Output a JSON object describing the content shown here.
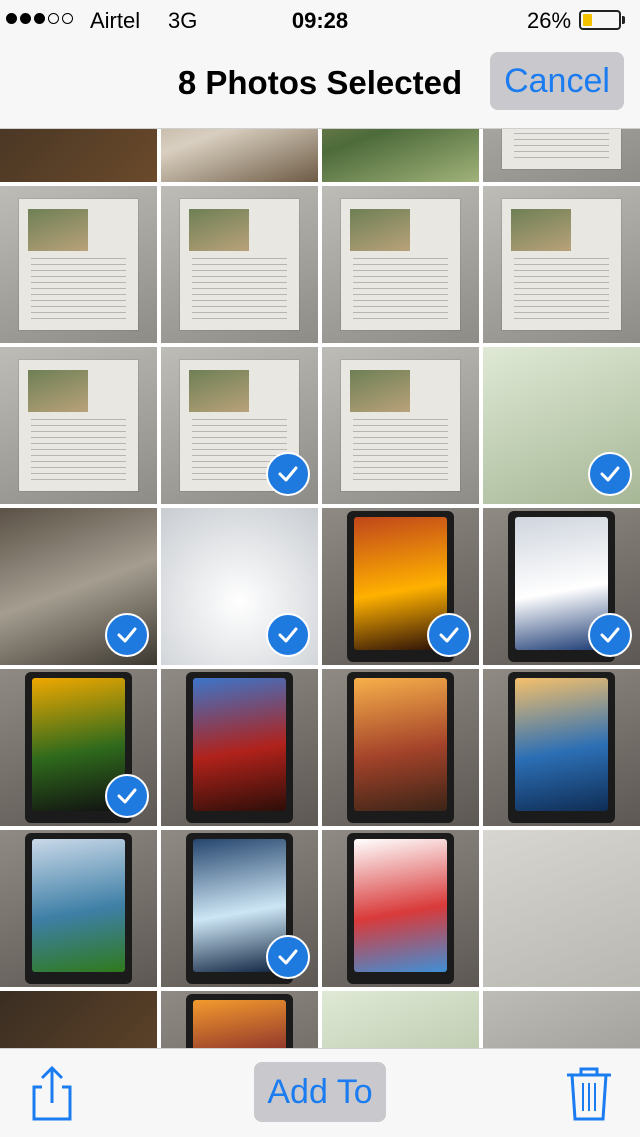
{
  "status_bar": {
    "signal_bars": [
      true,
      true,
      true,
      false,
      false
    ],
    "carrier": "Airtel",
    "network": "3G",
    "time": "09:28",
    "battery_percent": "26%",
    "battery_level": 0.26,
    "battery_color": "#f5c200"
  },
  "nav": {
    "title": "8 Photos Selected",
    "cancel_label": "Cancel"
  },
  "toolbar": {
    "share_icon": "share-icon",
    "add_to_label": "Add To",
    "trash_icon": "trash-icon"
  },
  "colors": {
    "accent": "#1a7cf0",
    "check_badge": "#1f7ae0",
    "bar_bg": "#f7f7f7",
    "button_bg": "#c9c9cd"
  },
  "photo_grid": {
    "selected_count": 8,
    "rows": [
      [
        {
          "kind": "photo",
          "theme": "t-dark",
          "selected": false
        },
        {
          "kind": "photo",
          "theme": "t-rock",
          "selected": false
        },
        {
          "kind": "photo",
          "theme": "t-garden",
          "selected": false
        },
        {
          "kind": "page",
          "theme": "t-grey",
          "selected": false
        }
      ],
      [
        {
          "kind": "page",
          "theme": "t-grey",
          "selected": false
        },
        {
          "kind": "page",
          "theme": "t-grey",
          "selected": false
        },
        {
          "kind": "page",
          "theme": "t-grey",
          "selected": false
        },
        {
          "kind": "page",
          "theme": "t-grey",
          "selected": false
        }
      ],
      [
        {
          "kind": "page",
          "theme": "t-grey",
          "selected": false
        },
        {
          "kind": "page",
          "theme": "t-grey",
          "selected": true
        },
        {
          "kind": "page",
          "theme": "t-grey",
          "selected": false
        },
        {
          "kind": "photo",
          "theme": "t-green",
          "selected": true
        }
      ],
      [
        {
          "kind": "photo",
          "theme": "t-books",
          "selected": true
        },
        {
          "kind": "photo",
          "theme": "t-snow",
          "selected": true
        },
        {
          "kind": "phone",
          "screen": [
            "#c0461b",
            "#ffb100",
            "#2a0f08"
          ],
          "selected": true
        },
        {
          "kind": "phone",
          "screen": [
            "#cfd5de",
            "#ffffff",
            "#1c3b74"
          ],
          "selected": true
        }
      ],
      [
        {
          "kind": "phone",
          "screen": [
            "#f0a800",
            "#2f6a1c",
            "#111111"
          ],
          "selected": true
        },
        {
          "kind": "phone",
          "screen": [
            "#3c75c9",
            "#b0221b",
            "#2d0e08"
          ],
          "selected": false
        },
        {
          "kind": "phone",
          "screen": [
            "#f7b04a",
            "#a4432a",
            "#3b2417"
          ],
          "selected": false
        },
        {
          "kind": "phone",
          "screen": [
            "#f5c06a",
            "#2c6fb5",
            "#0f2d55"
          ],
          "selected": false
        }
      ],
      [
        {
          "kind": "phone",
          "screen": [
            "#c9d8e8",
            "#3e7fa6",
            "#2f7a1c"
          ],
          "selected": false
        },
        {
          "kind": "phone",
          "screen": [
            "#26466e",
            "#cde6f5",
            "#0e2340"
          ],
          "selected": true
        },
        {
          "kind": "phone",
          "screen": [
            "#ffffff",
            "#d93a3a",
            "#3f8fd6"
          ],
          "selected": false
        },
        {
          "kind": "photo",
          "theme": "t-wall",
          "selected": false
        }
      ],
      [
        {
          "kind": "photo",
          "theme": "t-dark",
          "selected": false
        },
        {
          "kind": "phone",
          "screen": [
            "#f39a2e",
            "#7a1f2a",
            "#2a0d0f"
          ],
          "selected": false
        },
        {
          "kind": "photo",
          "theme": "t-green",
          "selected": false
        },
        {
          "kind": "photo",
          "theme": "t-grey",
          "selected": false
        }
      ]
    ]
  }
}
